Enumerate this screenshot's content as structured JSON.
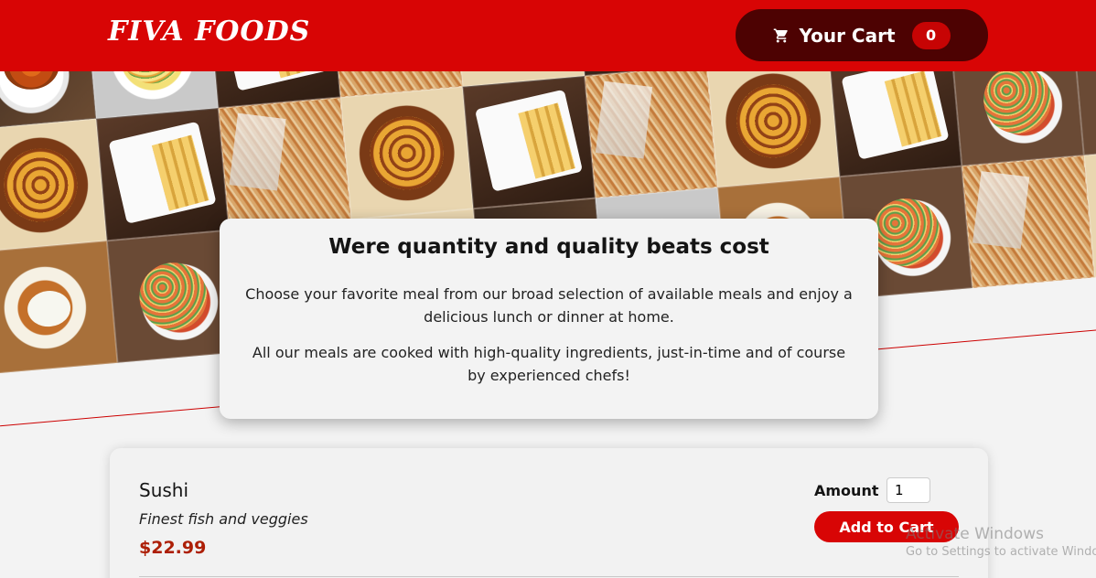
{
  "header": {
    "logo": "FIVA FOODS",
    "cart": {
      "label": "Your Cart",
      "count": "0",
      "icon": "cart-icon"
    }
  },
  "hero": {
    "tiles": [
      "jollof",
      "rice",
      "yamfries",
      "noodles",
      "plantain",
      "yamfries",
      "noodles",
      "plantain",
      "yamfries",
      "jollof",
      "plantain",
      "yamfries",
      "noodles",
      "plantain",
      "yamfries",
      "noodles",
      "plantain",
      "yamfries",
      "friedrice",
      "friedrice",
      "stew",
      "friedrice",
      "noodles",
      "plantain",
      "jollof",
      "rice",
      "stew",
      "friedrice",
      "noodles",
      "plantain"
    ]
  },
  "intro": {
    "title": "Were quantity and quality beats cost",
    "paragraph1": "Choose your favorite meal from our broad selection of available meals and enjoy a delicious lunch or dinner at home.",
    "paragraph2": "All our meals are cooked with high-quality ingredients, just-in-time and of course by experienced chefs!"
  },
  "meals": [
    {
      "name": "Sushi",
      "description": "Finest fish and veggies",
      "price": "$22.99",
      "amount_label": "Amount",
      "amount_value": "1",
      "add_label": "Add to Cart"
    }
  ],
  "watermark": {
    "title": "Activate Windows",
    "subtitle": "Go to Settings to activate Windows."
  },
  "colors": {
    "brand_red": "#d80505",
    "cart_bg": "#4d0202",
    "price_red": "#ad1f06"
  }
}
